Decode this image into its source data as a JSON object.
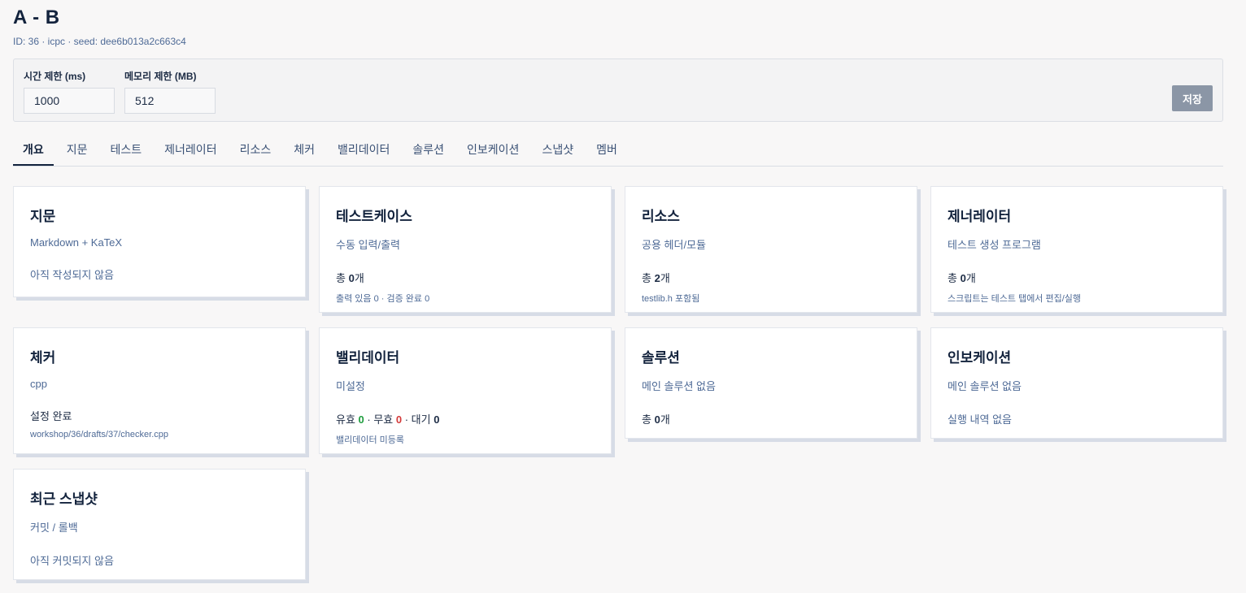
{
  "problem": {
    "title": "A - B",
    "meta": "ID: 36 · icpc · seed: dee6b013a2c663c4"
  },
  "limits": {
    "time_label": "시간 제한 (ms)",
    "time_value": "1000",
    "memory_label": "메모리 제한 (MB)",
    "memory_value": "512",
    "save_label": "저장"
  },
  "tabs": [
    {
      "label": "개요",
      "active": true
    },
    {
      "label": "지문"
    },
    {
      "label": "테스트"
    },
    {
      "label": "제너레이터"
    },
    {
      "label": "리소스"
    },
    {
      "label": "체커"
    },
    {
      "label": "밸리데이터"
    },
    {
      "label": "솔루션"
    },
    {
      "label": "인보케이션"
    },
    {
      "label": "스냅샷"
    },
    {
      "label": "멤버"
    }
  ],
  "cards": {
    "statement": {
      "title": "지문",
      "subtitle": "Markdown + KaTeX",
      "status": "아직 작성되지 않음"
    },
    "testcases": {
      "title": "테스트케이스",
      "subtitle": "수동 입력/출력",
      "stat_prefix": "총 ",
      "stat_value": "0",
      "stat_suffix": "개",
      "note": "출력 있음 0 · 검증 완료 0"
    },
    "resources": {
      "title": "리소스",
      "subtitle": "공용 헤더/모듈",
      "stat_prefix": "총 ",
      "stat_value": "2",
      "stat_suffix": "개",
      "note": "testlib.h 포함됨"
    },
    "generator": {
      "title": "제너레이터",
      "subtitle": "테스트 생성 프로그램",
      "stat_prefix": "총 ",
      "stat_value": "0",
      "stat_suffix": "개",
      "note": "스크립트는 테스트 탭에서 편집/실행"
    },
    "checker": {
      "title": "체커",
      "subtitle": "cpp",
      "stat": "설정 완료",
      "note": "workshop/36/drafts/37/checker.cpp"
    },
    "validator": {
      "title": "밸리데이터",
      "subtitle": "미설정",
      "valid_label": "유효 ",
      "valid_value": "0",
      "invalid_label": " · 무효 ",
      "invalid_value": "0",
      "pending_label": " · 대기 ",
      "pending_value": "0",
      "note": "밸리데이터 미등록",
      "valid_color": "#1f9d3e",
      "invalid_color": "#d43a3a"
    },
    "solution": {
      "title": "솔루션",
      "subtitle": "메인 솔루션 없음",
      "stat_prefix": "총 ",
      "stat_value": "0",
      "stat_suffix": "개"
    },
    "invocation": {
      "title": "인보케이션",
      "subtitle": "메인 솔루션 없음",
      "status": "실행 내역 없음"
    },
    "snapshot": {
      "title": "최근 스냅샷",
      "subtitle": "커밋 / 롤백",
      "status": "아직 커밋되지 않음"
    }
  }
}
